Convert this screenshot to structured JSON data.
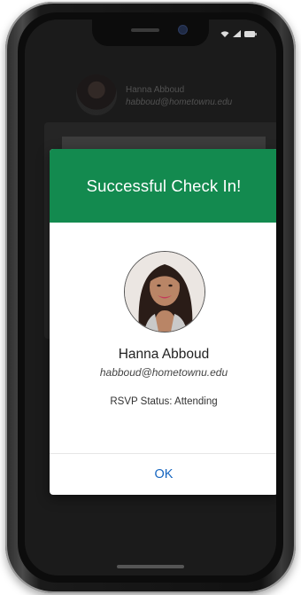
{
  "background_row": {
    "name": "Hanna Abboud",
    "email": "habboud@hometownu.edu"
  },
  "modal": {
    "title": "Successful Check In!",
    "name": "Hanna Abboud",
    "email": "habboud@hometownu.edu",
    "rsvp": "RSVP Status: Attending",
    "ok_label": "OK"
  },
  "colors": {
    "header_green": "#138a4f",
    "ok_blue": "#1565c0"
  },
  "icons": [
    "wifi-icon",
    "signal-icon",
    "battery-icon"
  ]
}
